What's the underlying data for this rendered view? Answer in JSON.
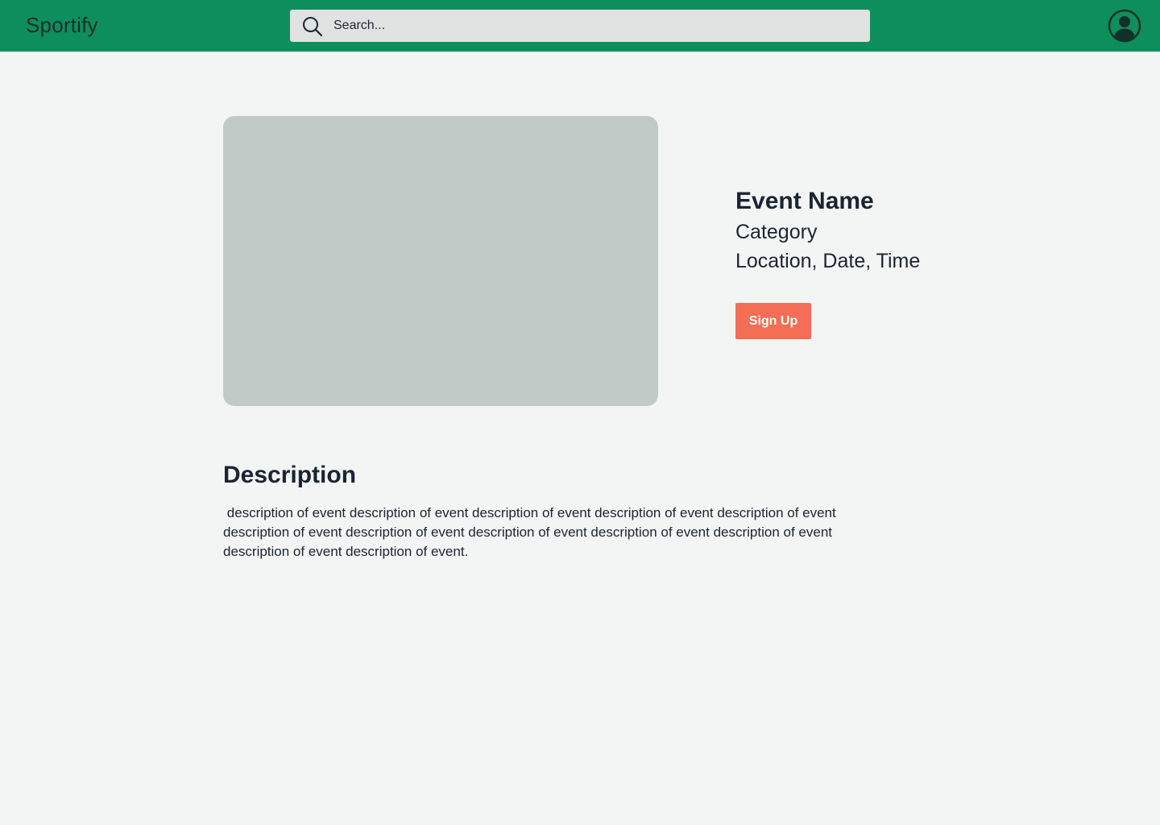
{
  "header": {
    "logo": "Sportify",
    "search_placeholder": "Search...",
    "search_icon": "search-icon",
    "profile_icon": "user-circle-icon",
    "background_color": "#0e8e5c"
  },
  "event": {
    "name": "Event Name",
    "category": "Category",
    "details": "Location, Date, Time",
    "signup_label": "Sign Up",
    "accent_color": "#f46d55"
  },
  "description": {
    "heading": "Description",
    "text": " description of event description of event description of event description of event description of event description of event description of event description of event description of event description of event description of event description of event."
  }
}
